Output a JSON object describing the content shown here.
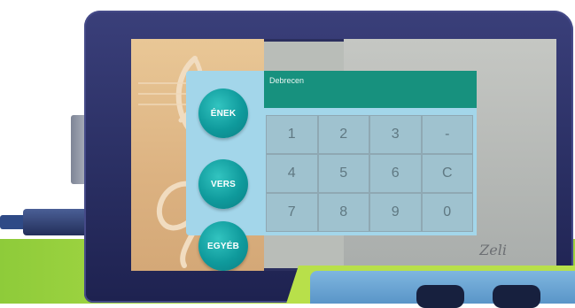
{
  "display": {
    "text": "Debrecen"
  },
  "mode_buttons": [
    {
      "label": "ÉNEK"
    },
    {
      "label": "VERS"
    },
    {
      "label": "EGYÉB"
    }
  ],
  "keypad": {
    "keys": [
      "1",
      "2",
      "3",
      "-",
      "4",
      "5",
      "6",
      "C",
      "7",
      "8",
      "9",
      "0"
    ]
  },
  "signature": "Zeli",
  "colors": {
    "device_body": "#2a2f63",
    "display_bar": "#17917e",
    "panel": "#a3d6ea",
    "button": "#0f9a9c",
    "green_band": "#9fd23e"
  },
  "icons": [
    "treble-clef-icon"
  ]
}
